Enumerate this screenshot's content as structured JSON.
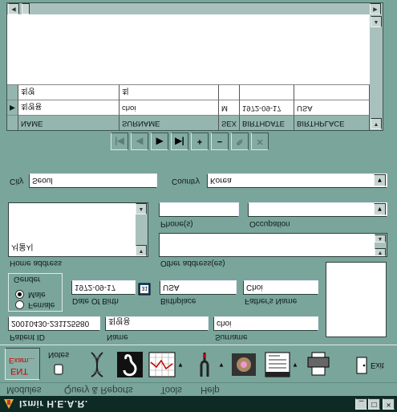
{
  "window": {
    "title": "Izmir H.E.A.R.",
    "min": "_",
    "max": "□",
    "close": "×"
  },
  "menu": [
    "Modules",
    "Query & Reports",
    "Tools",
    "Help"
  ],
  "toolbar": {
    "exam_line1": "Exam...",
    "exam_line2": "ENT",
    "notes": "Notes",
    "exit": "Exit"
  },
  "form": {
    "patient_id_label": "Patient ID",
    "patient_id": "20010430-231125580",
    "name_label": "Name",
    "name": "최영용",
    "surname_label": "Surname",
    "surname": "choi",
    "gender_label": "Gender",
    "male": "Male",
    "female": "Female",
    "gender_selected": "Male",
    "dob_label": "Date Of Birth",
    "dob": "1972-09-17",
    "birthplace_label": "Birthplace",
    "birthplace": "USA",
    "father_label": "Father's Name",
    "father": "Choi",
    "home_address_label": "Home address",
    "home_address": "서울시",
    "other_address_label": "Other address(es)",
    "other_address": "",
    "phone_label": "Phone(s)",
    "phone": "",
    "occupation_label": "Occupation",
    "occupation": "",
    "city_label": "City",
    "city": "Seoul",
    "country_label": "Country",
    "country": "Korea"
  },
  "grid": {
    "columns": [
      "NAME",
      "SURNAME",
      "SEX",
      "BIRTHDATE",
      "BIRTHPLACE"
    ],
    "rows": [
      [
        "최영용",
        "choi",
        "M",
        "1972-09-17",
        "USA"
      ],
      [
        "최영",
        "최",
        "",
        "",
        ""
      ]
    ]
  }
}
